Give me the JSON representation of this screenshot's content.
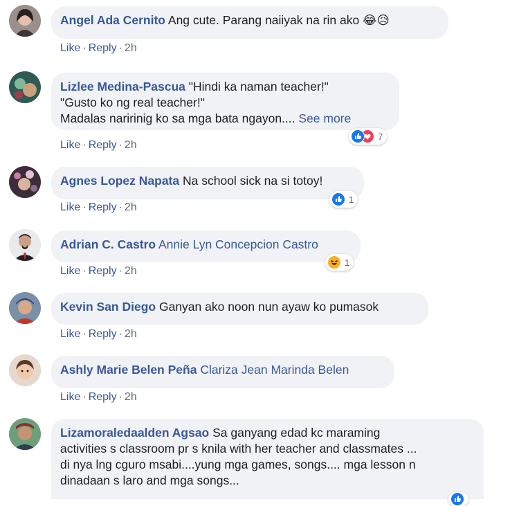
{
  "actions": {
    "like": "Like",
    "reply": "Reply",
    "sep": "·"
  },
  "comments": [
    {
      "author": "Angel Ada Cernito",
      "text": "Ang cute. Parang naiiyak na rin ako 😂😥",
      "time": "2h"
    },
    {
      "author": "Lizlee Medina-Pascua",
      "line1": "\"Hindi ka naman teacher!\"",
      "line2": "\"Gusto ko ng real teacher!\"",
      "line3": "Madalas naririnig ko sa mga bata ngayon....",
      "see_more": "See more",
      "time": "2h",
      "reaction_count": "7",
      "reactions": [
        "like-icon",
        "love-icon"
      ]
    },
    {
      "author": "Agnes Lopez Napata",
      "text": "Na school sick na si totoy!",
      "time": "2h",
      "reaction_count": "1",
      "reactions": [
        "like-icon"
      ]
    },
    {
      "author": "Adrian C. Castro",
      "tagged": "Annie Lyn Concepcion Castro",
      "time": "2h",
      "reaction_count": "1",
      "reactions": [
        "haha-icon"
      ]
    },
    {
      "author": "Kevin San Diego",
      "text": "Ganyan ako noon nun ayaw ko pumasok",
      "time": "2h"
    },
    {
      "author": "Ashly Marie Belen Peña",
      "tagged": "Clariza Jean Marinda Belen",
      "time": "2h"
    },
    {
      "author": "Lizamoraledaalden Agsao",
      "line1": "Sa ganyang edad kc maraming",
      "line2": "activities s classroom pr s knila with her teacher and classmates ...",
      "line3": "di nya lng cguro msabi....yung mga games, songs.... mga lesson n",
      "line4": "dinadaan s laro and mga songs...",
      "reactions": [
        "like-icon"
      ]
    }
  ],
  "colors": {
    "link": "#385898",
    "bubble": "#f0f2f5",
    "like_blue": "#1877f2",
    "love_red": "#f33e58",
    "haha_yellow": "#f7b125"
  }
}
